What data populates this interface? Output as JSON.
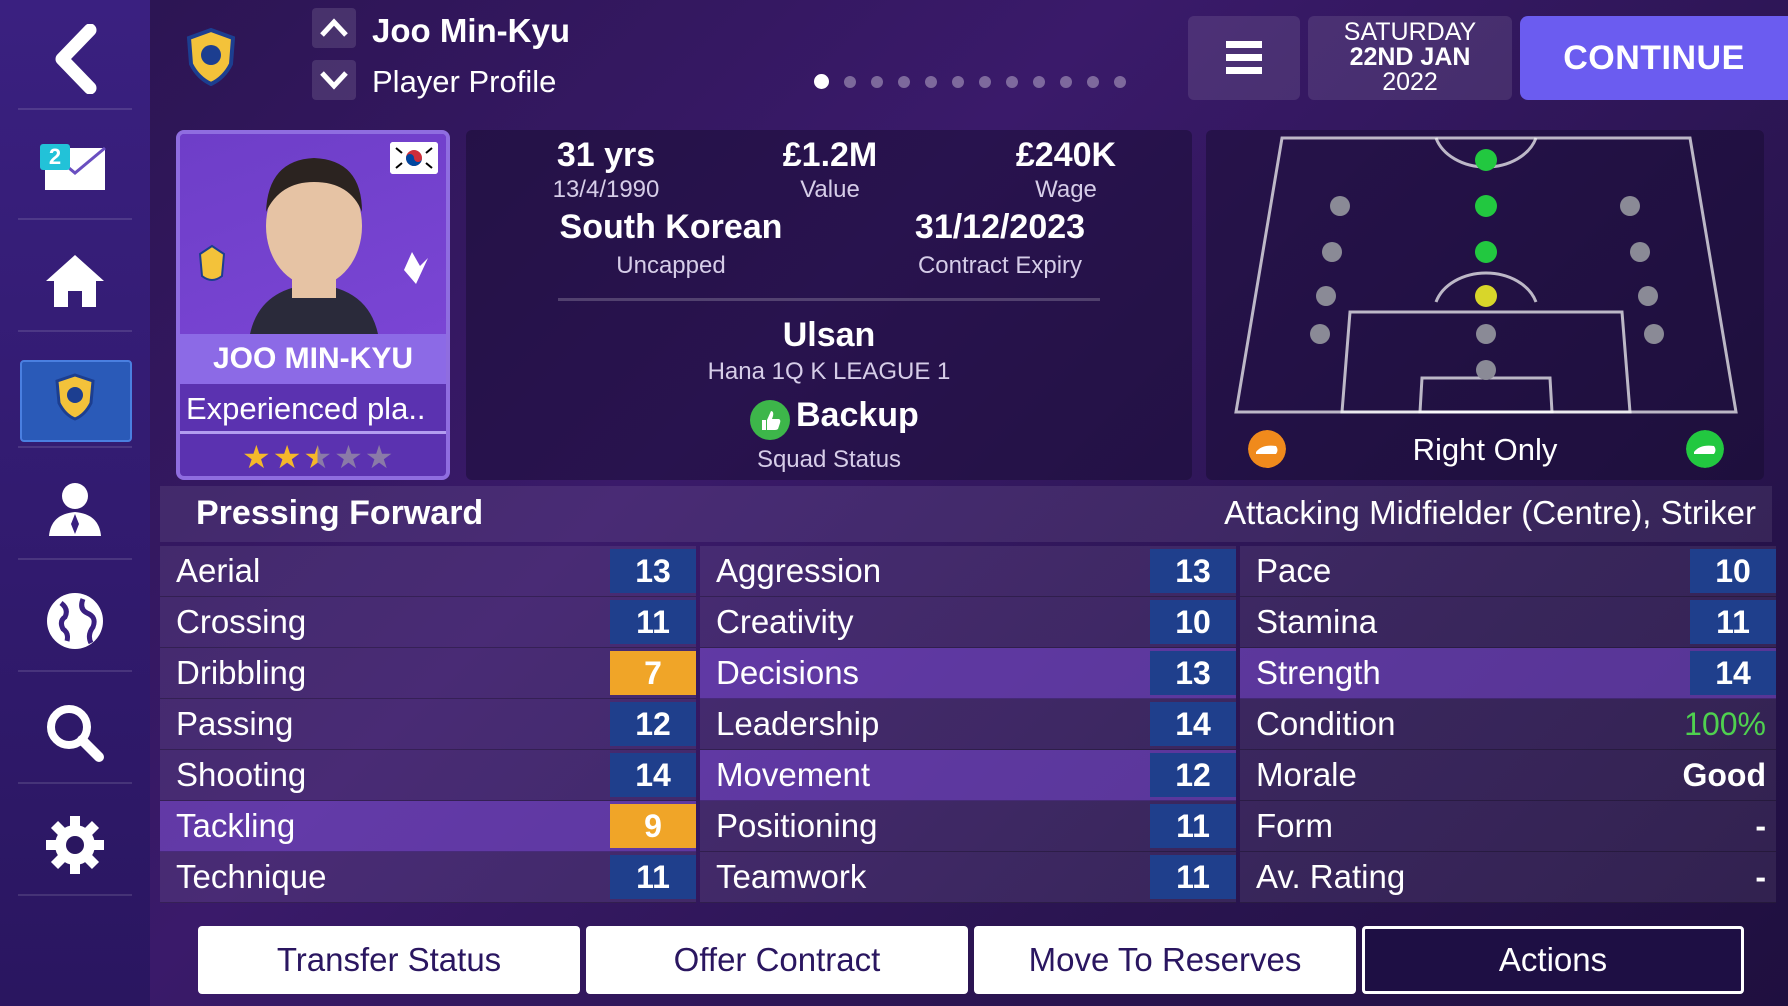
{
  "header": {
    "player_name": "Joo Min-Kyu",
    "subtitle": "Player Profile",
    "pages": 12,
    "active_page": 0
  },
  "sidebar": {
    "mail_count": "2"
  },
  "date": {
    "weekday": "SATURDAY",
    "day_month": "22ND JAN",
    "year": "2022"
  },
  "continue_label": "CONTINUE",
  "card": {
    "name": "JOO MIN-KYU",
    "description": "Experienced pla..",
    "stars": 2.5,
    "stars_max": 5
  },
  "info": {
    "age": "31 yrs",
    "dob": "13/4/1990",
    "value": "£1.2M",
    "value_label": "Value",
    "wage": "£240K",
    "wage_label": "Wage",
    "nationality": "South Korean",
    "caps": "Uncapped",
    "contract": "31/12/2023",
    "contract_label": "Contract Expiry",
    "club": "Ulsan",
    "league": "Hana 1Q K LEAGUE 1",
    "squad_status": "Backup",
    "squad_status_label": "Squad Status"
  },
  "pitch": {
    "foot_label": "Right Only"
  },
  "role": {
    "name": "Pressing Forward",
    "positions": "Attacking Midfielder (Centre), Striker"
  },
  "attributes": {
    "technical": [
      {
        "label": "Aerial",
        "value": "13"
      },
      {
        "label": "Crossing",
        "value": "11"
      },
      {
        "label": "Dribbling",
        "value": "7"
      },
      {
        "label": "Passing",
        "value": "12"
      },
      {
        "label": "Shooting",
        "value": "14"
      },
      {
        "label": "Tackling",
        "value": "9"
      },
      {
        "label": "Technique",
        "value": "11"
      }
    ],
    "mental": [
      {
        "label": "Aggression",
        "value": "13"
      },
      {
        "label": "Creativity",
        "value": "10"
      },
      {
        "label": "Decisions",
        "value": "13"
      },
      {
        "label": "Leadership",
        "value": "14"
      },
      {
        "label": "Movement",
        "value": "12"
      },
      {
        "label": "Positioning",
        "value": "11"
      },
      {
        "label": "Teamwork",
        "value": "11"
      }
    ],
    "physical": [
      {
        "label": "Pace",
        "value": "10"
      },
      {
        "label": "Stamina",
        "value": "11"
      },
      {
        "label": "Strength",
        "value": "14"
      },
      {
        "label": "Condition",
        "value": "100%"
      },
      {
        "label": "Morale",
        "value": "Good"
      },
      {
        "label": "Form",
        "value": "-"
      },
      {
        "label": "Av. Rating",
        "value": "-"
      }
    ]
  },
  "buttons": {
    "transfer": "Transfer Status",
    "offer": "Offer Contract",
    "reserves": "Move To Reserves",
    "actions": "Actions"
  },
  "colors": {
    "accent": "#6b5cf0",
    "attr_box": "#1f3f8c",
    "attr_warn": "#f0a528",
    "good": "#4fd14f"
  }
}
